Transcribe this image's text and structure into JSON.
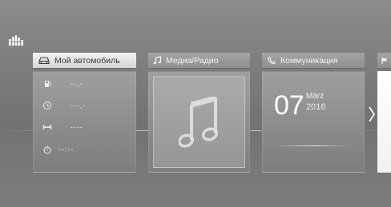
{
  "tiles": {
    "car": {
      "title": "Мой автомобиль",
      "icon": "car-icon",
      "rows": [
        {
          "icon": "fuel-icon",
          "value": "--,-"
        },
        {
          "icon": "clock-icon",
          "value": "---,-"
        },
        {
          "icon": "range-icon",
          "value": "----"
        },
        {
          "icon": "stopwatch-icon",
          "value": "--:--"
        }
      ]
    },
    "media": {
      "title": "Медиа/Радио",
      "icon": "music-note-icon"
    },
    "communication": {
      "title": "Коммуникация",
      "icon": "phone-icon",
      "day": "07",
      "month": "März",
      "year": "2016"
    }
  },
  "colors": {
    "background": "#7d7d7d",
    "active_header": "#e6e6e6",
    "tile_body": "#959595"
  }
}
